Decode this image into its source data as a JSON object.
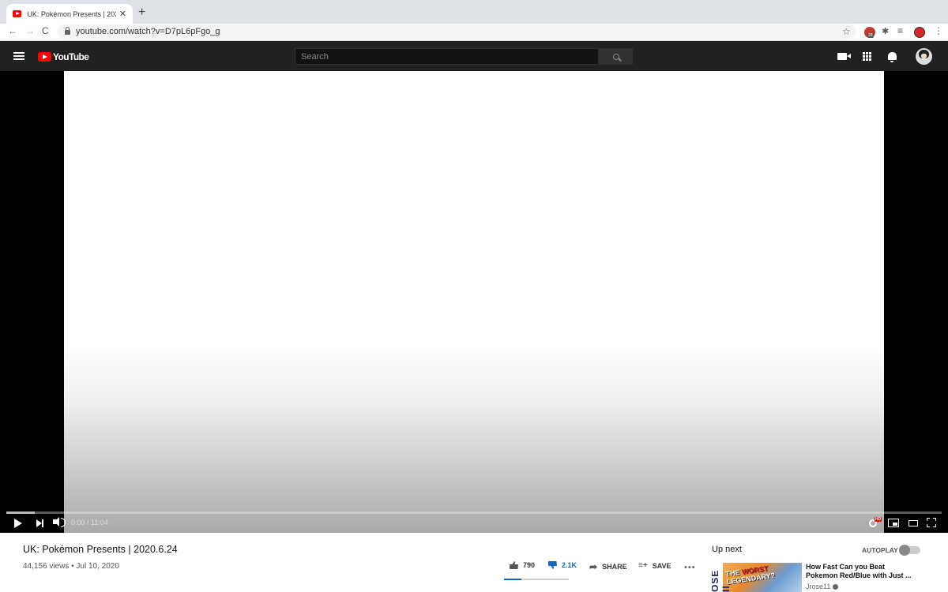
{
  "browser": {
    "tab_title": "UK: Pokémon Presents | 2020.6.24",
    "new_tab": "+",
    "tab_close": "✕",
    "back": "←",
    "forward": "→",
    "reload": "C",
    "url": "youtube.com/watch?v=D7pL6pFgo_g",
    "star": "☆",
    "extension_badge": "28",
    "menu": "⋮"
  },
  "masthead": {
    "logo_text": "YouTube",
    "search_placeholder": "Search"
  },
  "player": {
    "time": "0:00 / 11:04",
    "buffered_fraction": 0.03,
    "hd_label": "HD"
  },
  "video": {
    "title": "UK: Pokémon Presents | 2020.6.24",
    "meta": "44,156 views • Jul 10, 2020",
    "likes": "790",
    "dislikes": "2.1K",
    "share_label": "SHARE",
    "save_label": "SAVE",
    "more": "•••",
    "like_fraction": 0.27
  },
  "sidebar": {
    "up_next_label": "Up next",
    "autoplay_label": "AUTOPLAY",
    "autoplay_on": false,
    "recommendation": {
      "title": "How Fast Can you Beat Pokemon Red/Blue with Just ...",
      "channel": "Jrose11",
      "thumb_text_line1": "THE ",
      "thumb_text_red": "WORST",
      "thumb_text_line2": "LEGENDARY?",
      "thumb_side_text": "OSE II"
    }
  },
  "colors": {
    "masthead_bg": "#212121",
    "youtube_red": "#ff0000",
    "dislike_blue": "#1565c0"
  },
  "icons": [
    "youtube-favicon",
    "lock-icon",
    "star-icon",
    "puzzle-icon",
    "menu-icon",
    "search-icon",
    "video-camera-icon",
    "apps-icon",
    "bell-icon",
    "play-icon",
    "next-icon",
    "volume-icon",
    "settings-icon",
    "miniplayer-icon",
    "theater-icon",
    "fullscreen-icon",
    "thumbs-up-icon",
    "thumbs-down-icon",
    "share-icon",
    "save-icon",
    "verified-icon"
  ]
}
